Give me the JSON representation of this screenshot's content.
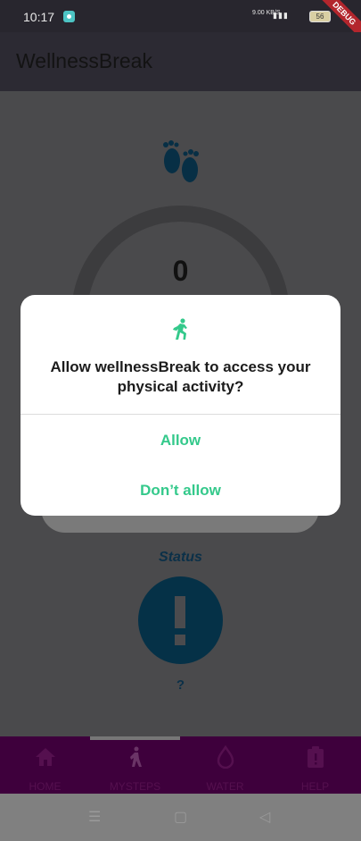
{
  "status_bar": {
    "time": "10:17",
    "net_speed": "9.00 KB/S",
    "battery": "56",
    "debug_banner": "DEBUG"
  },
  "app_bar": {
    "title": "WellnessBreak"
  },
  "main": {
    "step_count": "0",
    "status_label": "Status",
    "status_value": "?"
  },
  "bottom_nav": {
    "items": [
      {
        "label": "HOME",
        "icon": "home-icon"
      },
      {
        "label": "MYSTEPS",
        "icon": "walk-icon"
      },
      {
        "label": "WATER",
        "icon": "water-drop-icon"
      },
      {
        "label": "HELP",
        "icon": "help-clipboard-icon"
      }
    ]
  },
  "dialog": {
    "icon": "runner-icon",
    "message": "Allow wellnessBreak to access your physical activity?",
    "allow_label": "Allow",
    "deny_label": "Don’t allow",
    "accent_color": "#34c98b"
  },
  "colors": {
    "app_bar": "#2c2a33",
    "bottom_nav": "#3e003c",
    "status_circle": "#053147"
  }
}
